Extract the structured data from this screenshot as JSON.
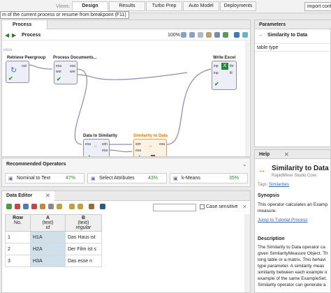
{
  "topbar": {
    "tooltip": "m of the current process or resume from breakpoint (F11)",
    "views_label": "Views:",
    "tabs": [
      "Design",
      "Results",
      "Turbo Prep",
      "Auto Model",
      "Deployments"
    ],
    "active_tab": "Design",
    "global_search_value": "import conf"
  },
  "process": {
    "tab_label": "Process",
    "breadcrumb": "Process",
    "zoom": "100%",
    "canvas_label": "cess",
    "operators": [
      {
        "name": "Retrieve Peergroup",
        "ports_out": [
          "out"
        ]
      },
      {
        "name": "Process Documents...",
        "ports_in": [
          "exa",
          "wor"
        ],
        "ports_out": [
          "exa",
          "wor"
        ]
      },
      {
        "name": "Write Excel",
        "ports_in": [
          "inp",
          "inp"
        ],
        "ports_out": [
          "thr",
          "fil"
        ]
      },
      {
        "name": "Data to Similarity",
        "ports_in": [
          "exa"
        ],
        "ports_out": [
          "sim",
          "exa"
        ]
      },
      {
        "name": "Similarity to Data",
        "ports_in": [
          "sim",
          "exa"
        ],
        "ports_out": [
          "exa"
        ]
      }
    ]
  },
  "recommended": {
    "title": "Recommended Operators",
    "items": [
      {
        "label": "Nominal to Text",
        "pct": "47%"
      },
      {
        "label": "Select Attributes",
        "pct": "43%"
      },
      {
        "label": "k-Means",
        "pct": "35%"
      }
    ]
  },
  "data_editor": {
    "tab_label": "Data Editor",
    "case_sensitive_label": "Case sensitive",
    "columns": [
      {
        "main": "Row",
        "sub": "No.",
        "role": ""
      },
      {
        "main": "A",
        "sub": "(text)",
        "role": "id"
      },
      {
        "main": "B",
        "sub": "(text)",
        "role": "regular"
      }
    ],
    "rows": [
      [
        "1",
        "H1A",
        "Das Haus ist"
      ],
      [
        "2",
        "H2A",
        "Der Film ist s"
      ],
      [
        "3",
        "H3A",
        "Das esse n"
      ]
    ]
  },
  "parameters": {
    "title": "Parameters",
    "operator": "Similarity to Data",
    "row": "table type"
  },
  "help": {
    "title": "Help",
    "op_title": "Similarity to Data",
    "subtitle": "RapidMiner Studio Core",
    "tags_label": "Tags:",
    "tags_value": "Similarities",
    "synopsis_heading": "Synopsis",
    "synopsis_lines": [
      "This operator calculates an Examp",
      "measure."
    ],
    "tutorial_link": "Jump to Tutorial Process",
    "description_heading": "Description",
    "description_lines": [
      "The Similarity to Data operator ca",
      "given SimilarityMeasure Object. Th",
      "long table or a matrix. This behavi",
      "type parameter. A similarity meas",
      "similarity between each example o",
      "example of the same ExampleSet.",
      "Similarity operator can generate a"
    ]
  },
  "colors": {
    "accent_orange": "#e07b00",
    "check_green": "#1f9a2a",
    "link_blue": "#3366aa"
  }
}
